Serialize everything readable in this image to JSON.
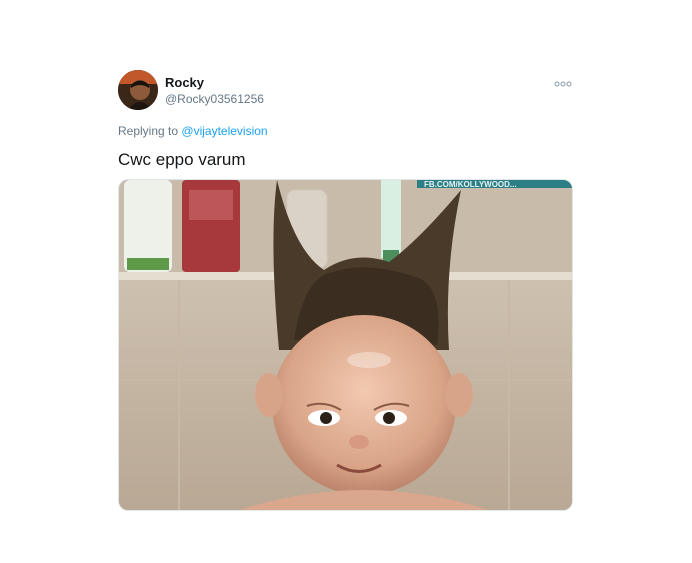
{
  "tweet": {
    "display_name": "Rocky",
    "handle": "@Rocky03561256",
    "replying_prefix": "Replying to",
    "replying_to": "@vijaytelevision",
    "text": "Cwc eppo varum",
    "more_icon": "more-dots-icon",
    "media": {
      "watermark": "FB.COM/KOLLYWOOD..."
    }
  },
  "colors": {
    "link": "#1da1f2",
    "secondary_text": "#657786",
    "primary_text": "#14171a",
    "border": "#e1e8ed"
  }
}
